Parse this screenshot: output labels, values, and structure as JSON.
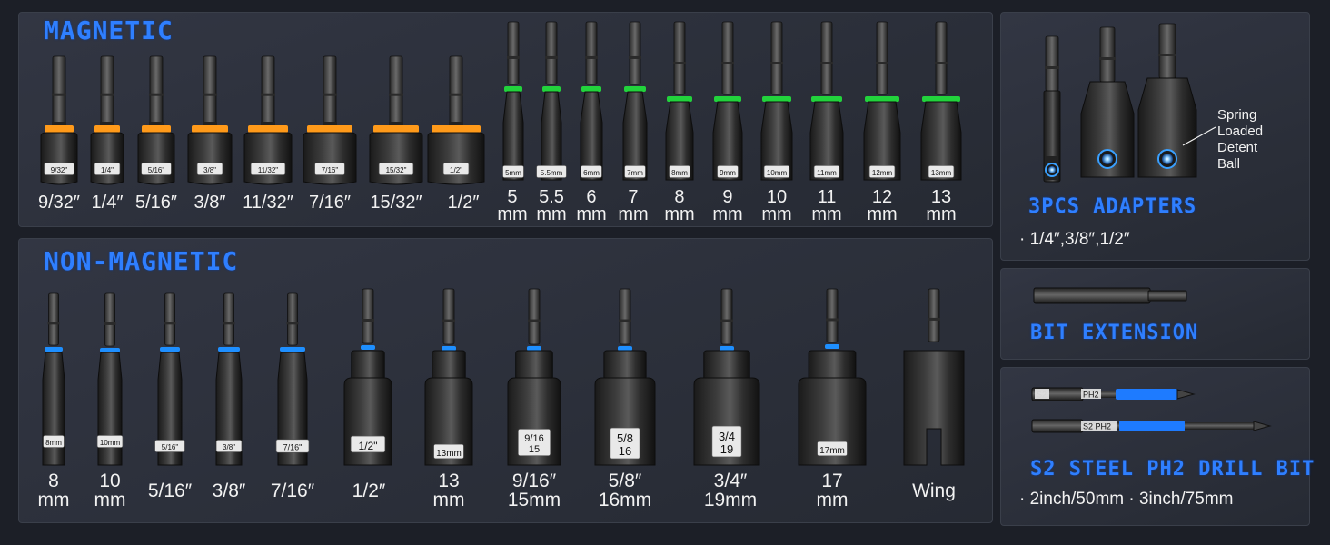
{
  "magnetic": {
    "heading": "MAGNETIC",
    "ring_color": "#ff9a1a",
    "metric_ring_color": "#22d33c",
    "sockets": [
      {
        "label": "9/32\"",
        "caption": "9/32″"
      },
      {
        "label": "1/4\"",
        "caption": "1/4″"
      },
      {
        "label": "5/16\"",
        "caption": "5/16″"
      },
      {
        "label": "3/8\"",
        "caption": "3/8″"
      },
      {
        "label": "11/32\"",
        "caption": "11/32″"
      },
      {
        "label": "7/16\"",
        "caption": "7/16″"
      },
      {
        "label": "15/32\"",
        "caption": "15/32″"
      },
      {
        "label": "1/2\"",
        "caption": "1/2″"
      },
      {
        "label": "5mm",
        "caption": "5\nmm"
      },
      {
        "label": "5.5mm",
        "caption": "5.5\nmm"
      },
      {
        "label": "6mm",
        "caption": "6\nmm"
      },
      {
        "label": "7mm",
        "caption": "7\nmm"
      },
      {
        "label": "8mm",
        "caption": "8\nmm"
      },
      {
        "label": "9mm",
        "caption": "9\nmm"
      },
      {
        "label": "10mm",
        "caption": "10\nmm"
      },
      {
        "label": "11mm",
        "caption": "11\nmm"
      },
      {
        "label": "12mm",
        "caption": "12\nmm"
      },
      {
        "label": "13mm",
        "caption": "13\nmm"
      }
    ]
  },
  "non_magnetic": {
    "heading": "NON-MAGNETIC",
    "ring_color": "#1e8fff",
    "sockets": [
      {
        "label": "8mm",
        "caption": "8\nmm"
      },
      {
        "label": "10mm",
        "caption": "10\nmm"
      },
      {
        "label": "5/16\"",
        "caption": "5/16″"
      },
      {
        "label": "3/8\"",
        "caption": "3/8″"
      },
      {
        "label": "7/16\"",
        "caption": "7/16″"
      },
      {
        "label": "1/2\"",
        "caption": "1/2″"
      },
      {
        "label": "13mm",
        "caption": "13\nmm"
      },
      {
        "label": "9/16\n15",
        "caption": "9/16″\n15mm"
      },
      {
        "label": "5/8\n16",
        "caption": "5/8″\n16mm"
      },
      {
        "label": "3/4\n19",
        "caption": "3/4″\n19mm"
      },
      {
        "label": "17mm",
        "caption": "17\nmm"
      },
      {
        "label": "",
        "caption": "Wing"
      }
    ]
  },
  "adapters": {
    "heading": "3PCS ADAPTERS",
    "sizes": "· 1/4″,3/8″,1/2″",
    "callout": "Spring\nLoaded\nDetent\nBall"
  },
  "extension": {
    "heading": "BIT EXTENSION"
  },
  "drill_bit": {
    "heading": "S2 STEEL PH2 DRILL BIT",
    "sizes": "· 2inch/50mm · 3inch/75mm",
    "bit_label_s2": "S2",
    "bit_label_ph2": "PH2",
    "bit_label_long": "S2 PH2",
    "stripe_color": "#1e7bff"
  }
}
